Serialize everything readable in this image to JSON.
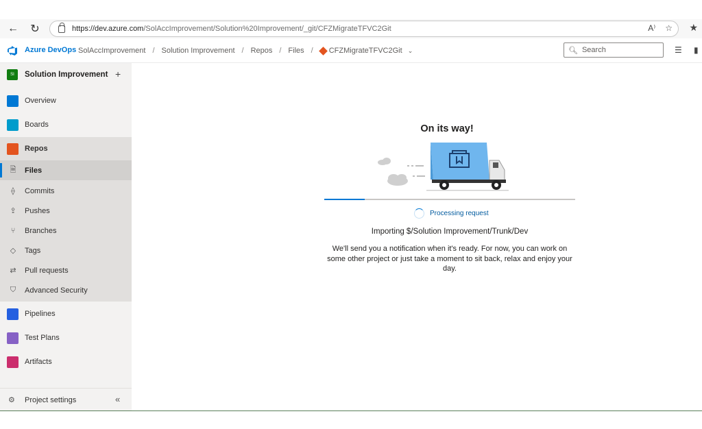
{
  "browser": {
    "url_host": "https://dev.azure.com",
    "url_rest": "/SolAccImprovement/Solution%20Improvement/_git/CFZMigrateTFVC2Git"
  },
  "header": {
    "brand": "Azure DevOps",
    "breadcrumbs": [
      "SolAccImprovement",
      "Solution Improvement",
      "Repos",
      "Files"
    ],
    "repo": "CFZMigrateTFVC2Git",
    "search_placeholder": "Search"
  },
  "sidebar": {
    "project_initials": "SI",
    "project_name": "Solution Improvement",
    "items": [
      {
        "label": "Overview",
        "icon": "overview-icon",
        "color": "#0078d4"
      },
      {
        "label": "Boards",
        "icon": "boards-icon",
        "color": "#009ccc"
      },
      {
        "label": "Repos",
        "icon": "repos-icon",
        "color": "#e3541f"
      },
      {
        "label": "Pipelines",
        "icon": "pipelines-icon",
        "color": "#2560e0"
      },
      {
        "label": "Test Plans",
        "icon": "test-plans-icon",
        "color": "#8661c5"
      },
      {
        "label": "Artifacts",
        "icon": "artifacts-icon",
        "color": "#cb2e6d"
      }
    ],
    "repo_subitems": [
      {
        "label": "Files",
        "icon": "files-icon",
        "glyph": "🗎"
      },
      {
        "label": "Commits",
        "icon": "commits-icon",
        "glyph": "⟠"
      },
      {
        "label": "Pushes",
        "icon": "pushes-icon",
        "glyph": "⇪"
      },
      {
        "label": "Branches",
        "icon": "branches-icon",
        "glyph": "⑂"
      },
      {
        "label": "Tags",
        "icon": "tags-icon",
        "glyph": "◇"
      },
      {
        "label": "Pull requests",
        "icon": "pull-requests-icon",
        "glyph": "⇄"
      },
      {
        "label": "Advanced Security",
        "icon": "shield-icon",
        "glyph": "⛉"
      }
    ],
    "settings_label": "Project settings"
  },
  "main": {
    "title": "On its way!",
    "processing": "Processing request",
    "progress": 0.16,
    "importing": "Importing $/Solution Improvement/Trunk/Dev",
    "notice": "We'll send you a notification when it's ready. For now, you can work on some other project or just take a moment to sit back, relax and enjoy your day."
  },
  "colors": {
    "accent": "#0078d4",
    "truck_box": "#6fb6ee"
  }
}
